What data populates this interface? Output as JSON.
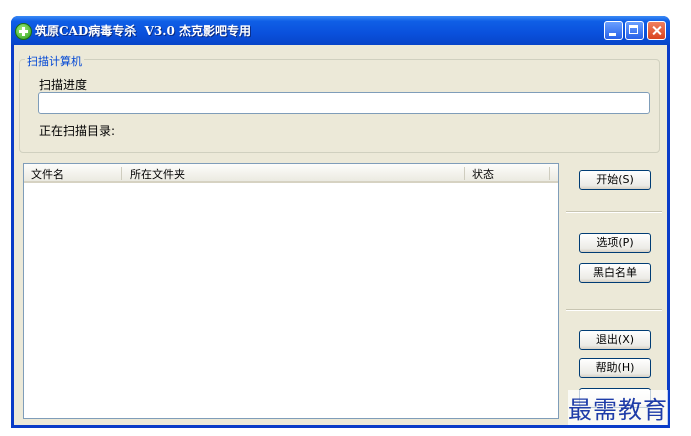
{
  "window": {
    "title": "筑原CAD病毒专杀  V3.0 杰克影吧专用"
  },
  "scan_group": {
    "title": "扫描计算机",
    "progress_label": "扫描进度",
    "progress": 0,
    "dir_label": "正在扫描目录:"
  },
  "list": {
    "columns": [
      "文件名",
      "所在文件夹",
      "状态"
    ],
    "rows": []
  },
  "buttons": {
    "start": "开始(S)",
    "options": "选项(P)",
    "blackwhite": "黑白名单",
    "exit": "退出(X)",
    "help": "帮助(H)"
  },
  "watermark": "最需教育"
}
